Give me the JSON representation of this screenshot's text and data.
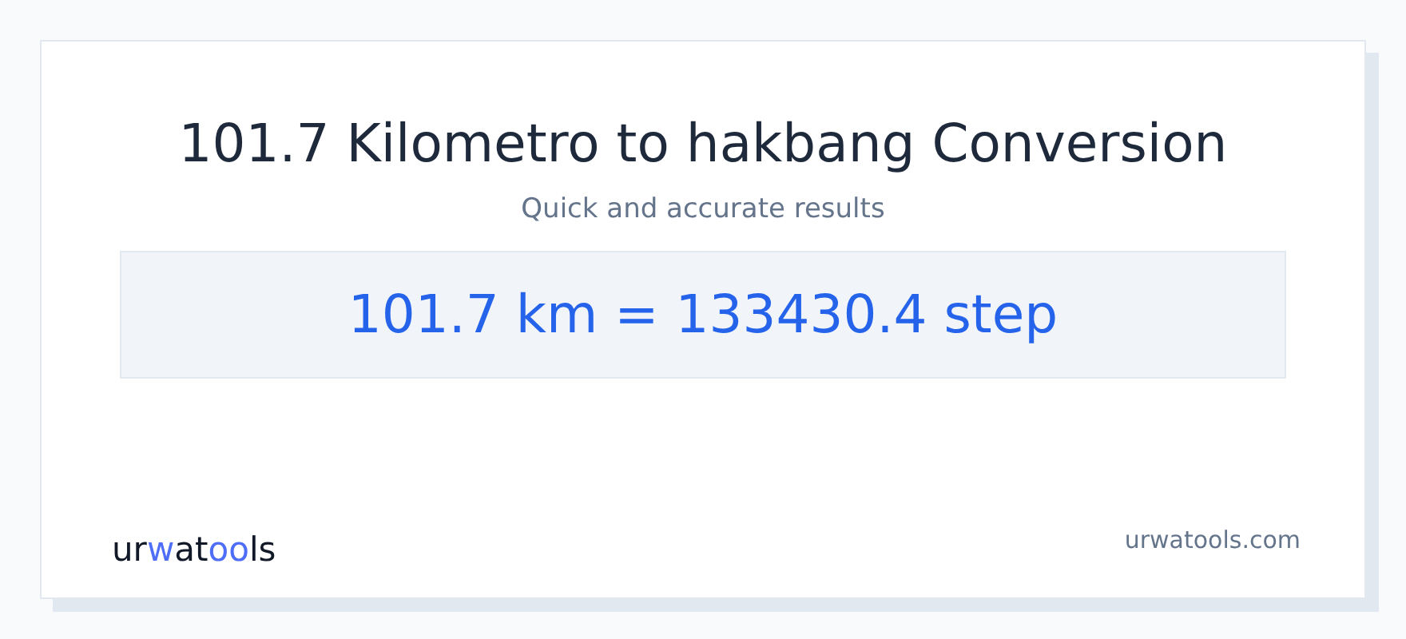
{
  "title": "101.7 Kilometro to hakbang Conversion",
  "subtitle": "Quick and accurate results",
  "result": "101.7 km = 133430.4 step",
  "logo": {
    "parts": [
      {
        "text": "ur",
        "accent": false
      },
      {
        "text": "w",
        "accent": true
      },
      {
        "text": "at",
        "accent": false
      },
      {
        "text": "oo",
        "accent": true
      },
      {
        "text": "ls",
        "accent": false
      }
    ]
  },
  "site": "urwatools.com"
}
